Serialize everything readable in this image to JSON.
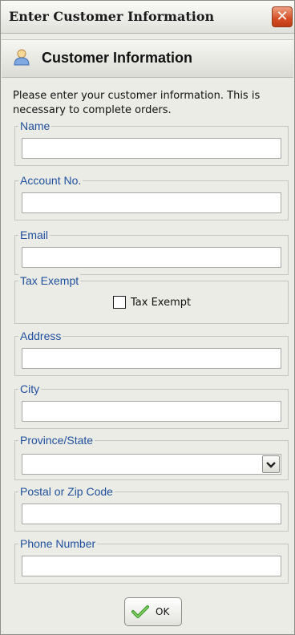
{
  "window": {
    "title": "Enter Customer Information",
    "close_icon": "close-icon",
    "close_glyph": "✕"
  },
  "header": {
    "title": "Customer Information",
    "icon": "user-icon"
  },
  "intro_text": "Please enter your customer information. This is necessary to complete orders.",
  "fields": {
    "name": {
      "label": "Name",
      "value": ""
    },
    "account": {
      "label": "Account No.",
      "value": ""
    },
    "email": {
      "label": "Email",
      "value": ""
    },
    "tax_exempt": {
      "label": "Tax Exempt",
      "checkbox_label": "Tax Exempt",
      "checked": false
    },
    "address": {
      "label": "Address",
      "value": ""
    },
    "city": {
      "label": "City",
      "value": ""
    },
    "province": {
      "label": "Province/State",
      "selected": ""
    },
    "postal": {
      "label": "Postal or Zip Code",
      "value": ""
    },
    "phone": {
      "label": "Phone Number",
      "value": ""
    }
  },
  "ok_button": {
    "label": "OK",
    "icon": "checkmark-icon"
  },
  "colors": {
    "legend_text": "#1e4f9e",
    "close_button": "#d44d24",
    "window_bg": "#ecece6"
  }
}
